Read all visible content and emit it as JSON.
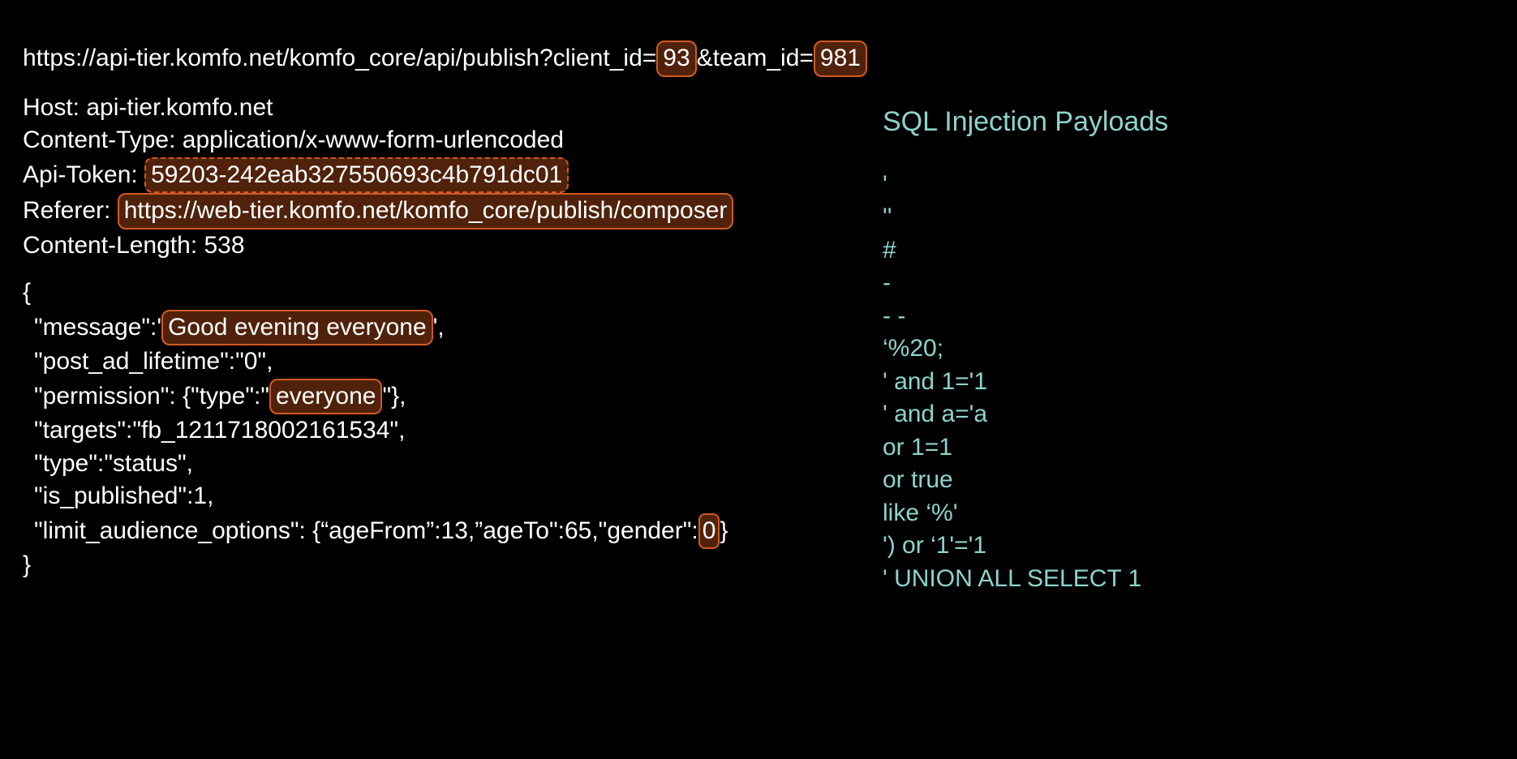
{
  "url": {
    "p1": "https://api-tier.komfo.net/komfo_core/api/publish?client_id=",
    "client_id": "93",
    "p2": "&team_id=",
    "team_id": "981"
  },
  "headers": {
    "host_label": "Host: ",
    "host_value": "api-tier.komfo.net",
    "ct_label": "Content-Type: ",
    "ct_value": "application/x-www-form-urlencoded",
    "token_label": "Api-Token: ",
    "token_value": "59203-242eab327550693c4b791dc01",
    "ref_label": "Referer: ",
    "ref_value": "https://web-tier.komfo.net/komfo_core/publish/composer",
    "cl_label": "Content-Length: ",
    "cl_value": "538"
  },
  "body": {
    "open": "{",
    "msg_pre": " \"message\":'",
    "msg_val": "Good evening everyone",
    "msg_post": "',",
    "life": " \"post_ad_lifetime\":\"0\",",
    "perm_pre": " \"permission\": {\"type\":\"",
    "perm_val": "everyone",
    "perm_post": "\"},",
    "targets": " \"targets\":\"fb_1211718002161534\",",
    "type": " \"type\":\"status\",",
    "ispub": " \"is_published\":1,",
    "limit_pre": " \"limit_audience_options\": {“ageFrom”:13,”ageTo\":65,\"gender\":",
    "limit_val": "0",
    "limit_post": "}",
    "close": "}"
  },
  "right": {
    "title": "SQL Injection Payloads",
    "items": [
      "'",
      "''",
      "#",
      "-",
      "- -",
      "‘%20;",
      "' and 1='1",
      "' and a='a",
      " or 1=1",
      " or true",
      "like ‘%'",
      "') or ‘1'='1",
      "' UNION ALL SELECT 1"
    ]
  }
}
